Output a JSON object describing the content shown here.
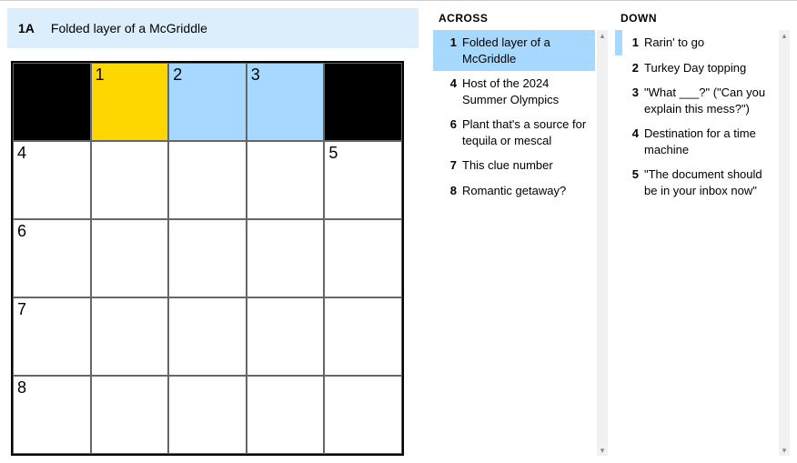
{
  "cluebar": {
    "num": "1A",
    "text": "Folded layer of a McGriddle"
  },
  "grid": {
    "rows": [
      [
        {
          "black": true
        },
        {
          "n": "1",
          "sel": true
        },
        {
          "n": "2",
          "word": true
        },
        {
          "n": "3",
          "word": true
        },
        {
          "black": true
        }
      ],
      [
        {
          "n": "4"
        },
        {},
        {},
        {},
        {
          "n": "5"
        }
      ],
      [
        {
          "n": "6"
        },
        {},
        {},
        {},
        {}
      ],
      [
        {
          "n": "7"
        },
        {},
        {},
        {},
        {}
      ],
      [
        {
          "n": "8"
        },
        {},
        {},
        {},
        {}
      ]
    ]
  },
  "across": {
    "heading": "ACROSS",
    "clues": [
      {
        "n": "1",
        "t": "Folded layer of a McGriddle",
        "active": true
      },
      {
        "n": "4",
        "t": "Host of the 2024 Summer Olympics"
      },
      {
        "n": "6",
        "t": "Plant that's a source for tequila or mescal"
      },
      {
        "n": "7",
        "t": "This clue number"
      },
      {
        "n": "8",
        "t": "Romantic getaway?"
      }
    ]
  },
  "down": {
    "heading": "DOWN",
    "clues": [
      {
        "n": "1",
        "t": "Rarin' to go",
        "cross": true
      },
      {
        "n": "2",
        "t": "Turkey Day topping"
      },
      {
        "n": "3",
        "t": "\"What ___?\" (\"Can you explain this mess?\")"
      },
      {
        "n": "4",
        "t": "Destination for a time machine"
      },
      {
        "n": "5",
        "t": "\"The document should be in your inbox now\""
      }
    ]
  },
  "scroll": {
    "up": "▴",
    "down": "▾"
  }
}
